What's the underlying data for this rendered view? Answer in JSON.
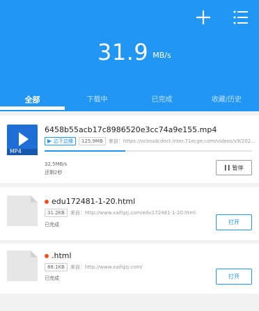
{
  "header": {
    "speed_value": "31.9",
    "speed_unit": "MB/s",
    "background_color": "#2196f3"
  },
  "toolbar": {
    "add_icon": "plus-icon",
    "menu_icon": "list-icon"
  },
  "tabs": [
    {
      "label": "全部",
      "active": true
    },
    {
      "label": "下载中",
      "active": false
    },
    {
      "label": "已完成",
      "active": false
    },
    {
      "label": "收藏/历史",
      "active": false
    }
  ],
  "downloads": [
    {
      "file_name": "6458b55acb17c8986520e3cc74a9e155.mp4",
      "thumb_label": "MP4",
      "play_tag": "边下边播",
      "size": "125.9MB",
      "source": "来自：https://octoudcdnct.inter.71ecge.com/videos/v9/202...",
      "progress_percent": 39,
      "speed": "32.5MB/s",
      "remaining": "还剩2秒",
      "button_label": "暂停"
    },
    {
      "file_name": "edu172481-1-20.html",
      "size": "31.2KB",
      "source": "来自：http://www.xaifqzj.com/edu172481-1-20.html",
      "status": "已完成",
      "button_label": "打开"
    },
    {
      "file_name": ".html",
      "size": "88.1KB",
      "source": "来自：http://www.xaifqzj.com/",
      "status": "已完成",
      "button_label": "打开"
    }
  ]
}
